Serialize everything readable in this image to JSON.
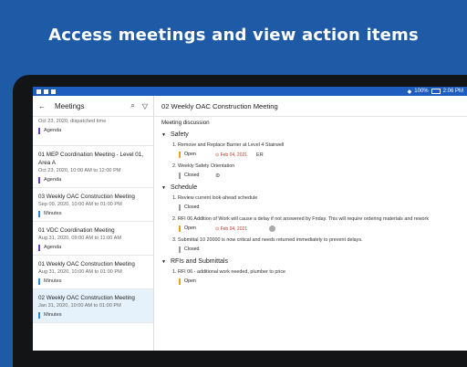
{
  "headline": "Access meetings and view action items",
  "statusbar": {
    "battery": "100%",
    "time": "2:06 PM"
  },
  "left_pane": {
    "title": "Meetings",
    "top_partial": {
      "date": "Oct 23, 2020, dispatched time",
      "tag": "Agenda"
    },
    "meetings": [
      {
        "title": "01 MEP Coordination Meeting - Level 01, Area A",
        "date": "Oct 23, 2020, 10:00 AM to 12:00 PM",
        "tag": "Agenda"
      },
      {
        "title": "03 Weekly OAC Construction Meeting",
        "date": "Sep 09, 2020, 10:00 AM to 01:00 PM",
        "tag": "Minutes"
      },
      {
        "title": "01 VDC Coordination Meeting",
        "date": "Aug 31, 2020, 09:00 AM to 11:00 AM",
        "tag": "Agenda"
      },
      {
        "title": "01 Weekly OAC Construction Meeting",
        "date": "Aug 31, 2020, 10:00 AM to 01:00 PM",
        "tag": "Minutes"
      },
      {
        "title": "02 Weekly OAC Construction Meeting",
        "date": "Jan 31, 2020, 10:00 AM to 01:00 PM",
        "tag": "Minutes"
      }
    ]
  },
  "right_pane": {
    "title": "02 Weekly OAC Construction Meeting",
    "subheading": "Meeting discussion",
    "sections": {
      "safety": {
        "title": "Safety",
        "items": [
          {
            "text": "1.  Remove and Replace Barrier at Level 4 Stairwell",
            "status": "Open",
            "due": "⊙ Feb 04, 2021",
            "assignee": "ER"
          },
          {
            "text": "2.  Weekly Safety Orientation",
            "status": "Closed"
          }
        ]
      },
      "schedule": {
        "title": "Schedule",
        "items": [
          {
            "text": "1.  Review current look-ahead schedule",
            "status": "Closed"
          },
          {
            "text": "2.  RFI 06 Addition of Work will cause a delay if not answered by Friday. This will require ordering materials and rework",
            "status": "Open",
            "due": "⊙ Feb 04, 2021"
          },
          {
            "text": "3.  Submittal 10 20000 is now critical and needs returned immediately to prevent delays.",
            "status": "Closed"
          }
        ]
      },
      "rfis": {
        "title": "RFIs and Submittals",
        "items": [
          {
            "text": "1.  RFI 06 - additional work needed, plumber to price",
            "status": "Open"
          }
        ]
      }
    }
  },
  "colors": {
    "brand": "#1f5aa6",
    "status_bar": "#1e5cc0",
    "open": "#e8a21a",
    "due": "#c0392b",
    "agenda": "#6a3fb8",
    "minutes": "#2c88d8",
    "selected": "#e5f2fb"
  }
}
